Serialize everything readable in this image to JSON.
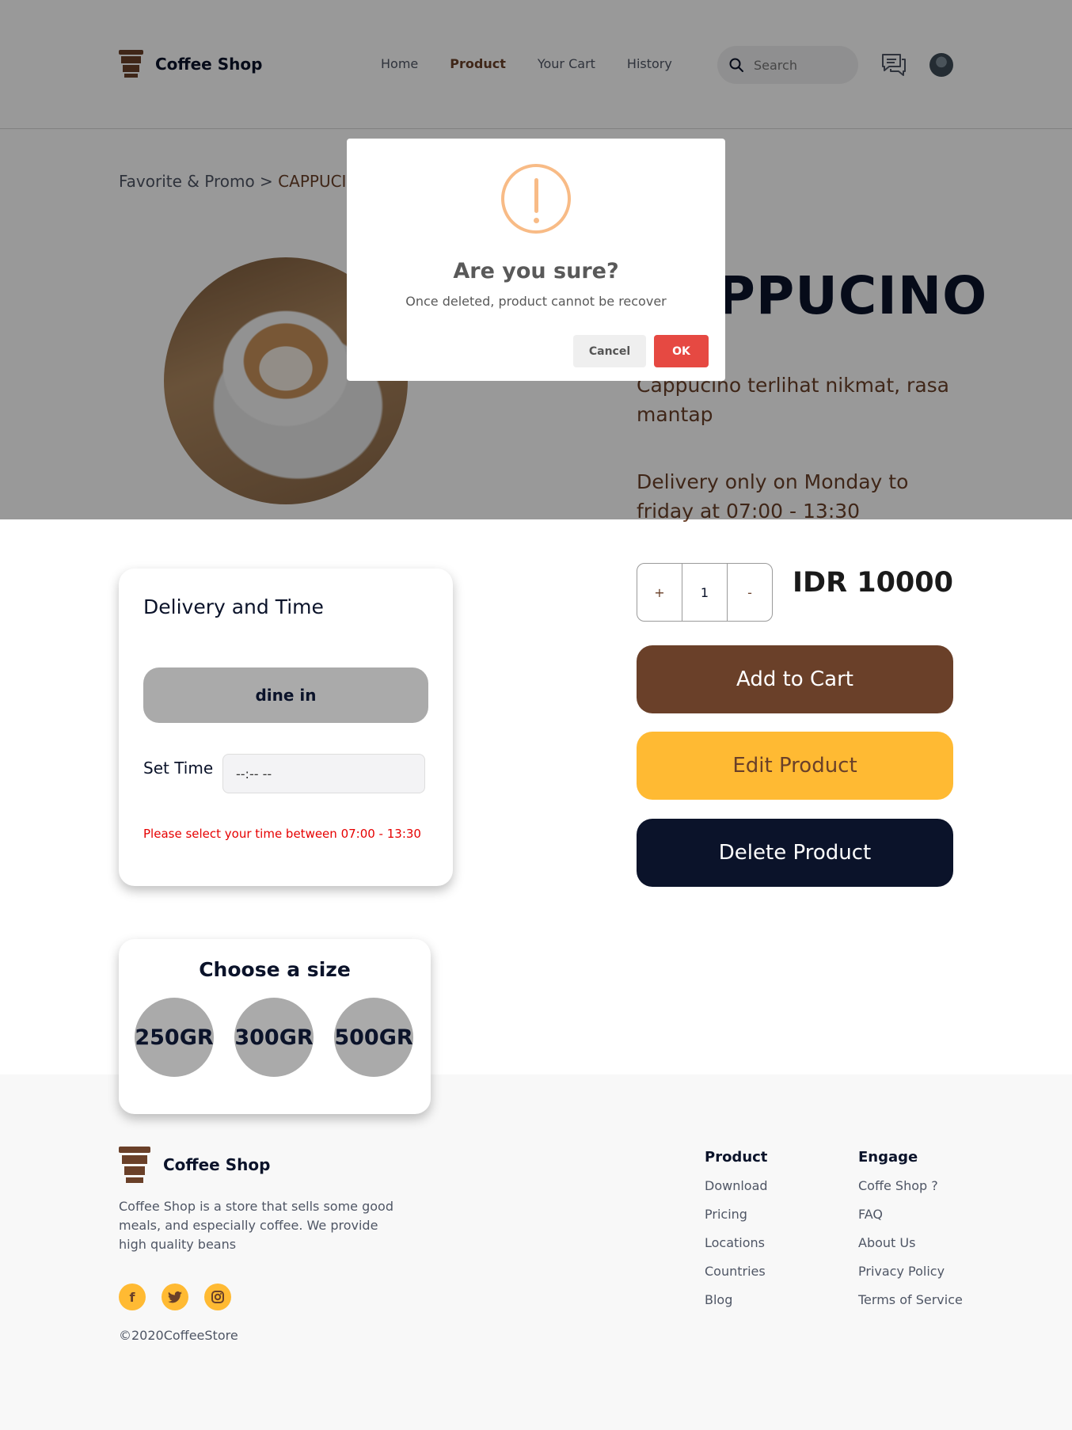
{
  "nav": {
    "brand": "Coffee Shop",
    "links": [
      "Home",
      "Product",
      "Your Cart",
      "History"
    ],
    "active_link": "Product",
    "search_placeholder": "Search"
  },
  "product": {
    "breadcrumb_parent": "Favorite & Promo",
    "breadcrumb_separator": ">",
    "breadcrumb_current": "CAPPUCINO",
    "title": "CAPPUCINO",
    "description": "Cappucino terlihat nikmat, rasa mantap",
    "delivery_prefix": "Delivery only on",
    "delivery_days": "Monday to friday",
    "delivery_mid": "at",
    "delivery_hours": "07:00 - 13:30"
  },
  "modal": {
    "title": "Are you sure?",
    "text": "Once deleted, product cannot be recover",
    "cancel_label": "Cancel",
    "ok_label": "OK"
  },
  "delivery_card": {
    "title": "Delivery and Time",
    "dine_label": "dine in",
    "set_time_label": "Set Time",
    "time_value": "--:-- --",
    "warning": "Please select your time between 07:00 - 13:30"
  },
  "quantity": {
    "plus": "+",
    "value": "1",
    "minus": "-"
  },
  "price": "IDR 10000",
  "actions": {
    "add_to_cart": "Add to Cart",
    "edit_product": "Edit Product",
    "delete_product": "Delete Product"
  },
  "sizes": {
    "title": "Choose a size",
    "options": [
      "250GR",
      "300GR",
      "500GR"
    ]
  },
  "footer": {
    "brand": "Coffee Shop",
    "description": "Coffee Shop is a store that sells some good meals, and especially coffee. We provide high quality beans",
    "socials": [
      "facebook",
      "twitter",
      "instagram"
    ],
    "copyright": "©2020CoffeeStore",
    "product_col": {
      "title": "Product",
      "links": [
        "Download",
        "Pricing",
        "Locations",
        "Countries",
        "Blog"
      ]
    },
    "engage_col": {
      "title": "Engage",
      "links": [
        "Coffe Shop ?",
        "FAQ",
        "About Us",
        "Privacy Policy",
        "Terms of Service"
      ]
    }
  },
  "colors": {
    "brand_brown": "#6a4029",
    "accent_yellow": "#ffba33",
    "dark_navy": "#0b132a",
    "danger_red": "#e64942",
    "warning_orange": "#f8bb86"
  }
}
